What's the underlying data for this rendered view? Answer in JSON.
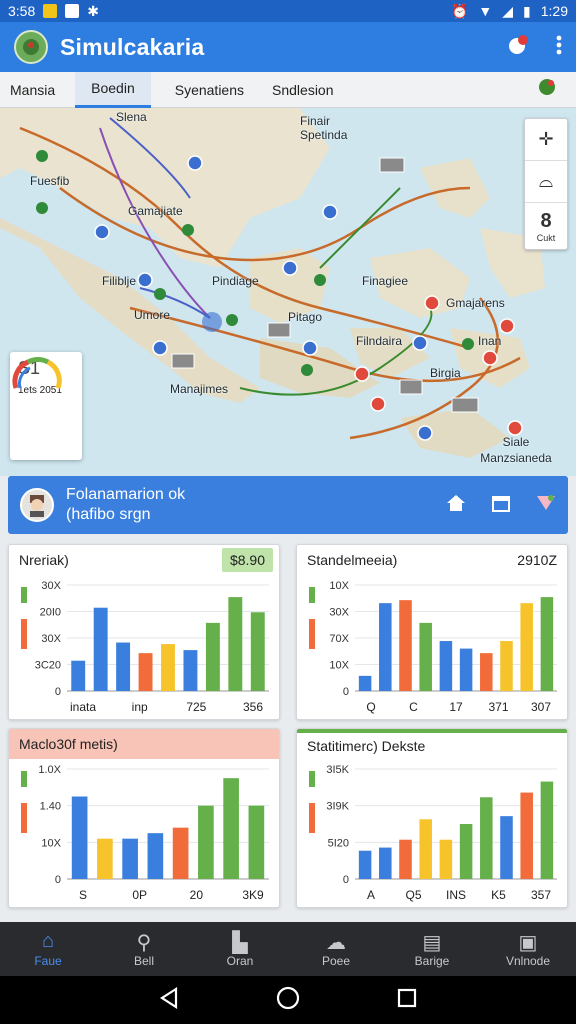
{
  "status_bar": {
    "left_time": "3:58",
    "right_time": "1:29"
  },
  "app": {
    "title": "Simulcakaria"
  },
  "tabs": [
    {
      "label": "Mansia"
    },
    {
      "label": "Boedin"
    },
    {
      "label": "Syenatiens"
    },
    {
      "label": "Sndlesion"
    }
  ],
  "map": {
    "labels": [
      "Slena",
      "Finair Spetinda",
      "Fuesfib",
      "Gamajiate",
      "Filiblje",
      "Pindiage",
      "Umore",
      "Pitago",
      "Finagiee",
      "Gmajarens",
      "Filndaira",
      "Inan",
      "Manajimes",
      "Birgia",
      "Siale Manzsianeda"
    ],
    "controls": {
      "bottom_label": "Cukt",
      "bottom_glyph": "8"
    },
    "score_card": {
      "title": "S1",
      "footer": "1ets 2051"
    }
  },
  "banner": {
    "line1": "Folanamarion ok",
    "line2": "(hafibo srgn"
  },
  "cards": [
    {
      "title": "Nreriak)",
      "value": "$8.90",
      "chart_data": {
        "type": "bar",
        "yticks": [
          "30X",
          "20I0",
          "30X",
          "3C20",
          "0"
        ],
        "xticks": [
          "inata",
          "inp",
          "725",
          "356"
        ],
        "values": [
          20,
          55,
          32,
          25,
          31,
          27,
          45,
          62,
          52
        ],
        "colors": [
          "#3a7fdd",
          "#3a7fdd",
          "#3a7fdd",
          "#f26b3a",
          "#f7c32b",
          "#3a7fdd",
          "#66b04c",
          "#66b04c",
          "#66b04c"
        ],
        "ymax": 70
      }
    },
    {
      "title": "Standelmeeia)",
      "value": "2910Z",
      "chart_data": {
        "type": "bar",
        "yticks": [
          "10X",
          "30X",
          "70X",
          "10X",
          "0"
        ],
        "xticks": [
          "Q",
          "C",
          "17",
          "371",
          "307"
        ],
        "values": [
          10,
          58,
          60,
          45,
          33,
          28,
          25,
          33,
          58,
          62
        ],
        "colors": [
          "#3a7fdd",
          "#3a7fdd",
          "#f26b3a",
          "#66b04c",
          "#3a7fdd",
          "#3a7fdd",
          "#f26b3a",
          "#f7c32b",
          "#f7c32b",
          "#66b04c"
        ],
        "ymax": 70
      }
    },
    {
      "title": "Maclo30f metis)",
      "value": "",
      "chart_data": {
        "type": "bar",
        "yticks": [
          "1.0X",
          "1.40",
          "10X",
          "0"
        ],
        "xticks": [
          "S",
          "0P",
          "20",
          "3K9"
        ],
        "values": [
          45,
          22,
          22,
          25,
          28,
          40,
          55,
          40
        ],
        "colors": [
          "#3a7fdd",
          "#f7c32b",
          "#3a7fdd",
          "#3a7fdd",
          "#f26b3a",
          "#66b04c",
          "#66b04c",
          "#66b04c"
        ],
        "ymax": 60
      }
    },
    {
      "title": "Statitimerc) Dekste",
      "value": "",
      "chart_data": {
        "type": "bar",
        "yticks": [
          "3I5K",
          "3I9K",
          "5I20",
          "0"
        ],
        "xticks": [
          "A",
          "Q5",
          "INS",
          "K5",
          "357"
        ],
        "values": [
          18,
          20,
          25,
          38,
          25,
          35,
          52,
          40,
          55,
          62
        ],
        "colors": [
          "#3a7fdd",
          "#3a7fdd",
          "#f26b3a",
          "#f7c32b",
          "#f7c32b",
          "#66b04c",
          "#66b04c",
          "#3a7fdd",
          "#f26b3a",
          "#66b04c"
        ],
        "ymax": 70
      }
    }
  ],
  "bottom_nav": [
    {
      "label": "Faue",
      "icon": "home-icon"
    },
    {
      "label": "Bell",
      "icon": "search-icon"
    },
    {
      "label": "Oran",
      "icon": "building-icon"
    },
    {
      "label": "Poee",
      "icon": "group-icon"
    },
    {
      "label": "Barige",
      "icon": "list-icon"
    },
    {
      "label": "Vnlnode",
      "icon": "image-icon"
    }
  ]
}
